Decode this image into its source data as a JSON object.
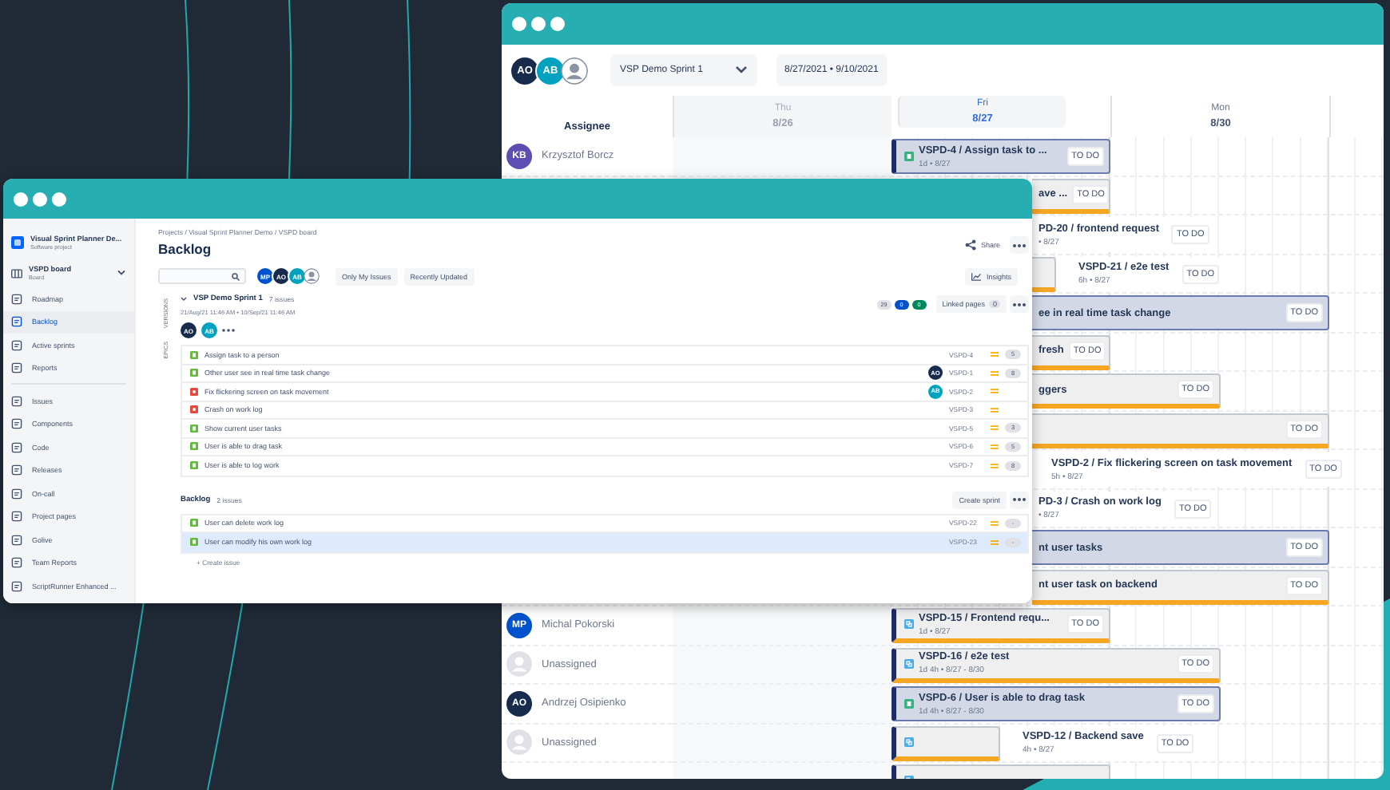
{
  "back_window": {
    "toolbar": {
      "avatars": [
        {
          "kind": "initials",
          "initials": "AO",
          "color": "#172b4d"
        },
        {
          "kind": "initials",
          "initials": "AB",
          "color": "#00a3bf"
        },
        {
          "kind": "unassigned"
        }
      ],
      "sprint_select": "VSP Demo Sprint 1",
      "date_range": "8/27/2021 • 9/10/2021"
    },
    "assignee_header": "Assignee",
    "days": [
      {
        "weekday": "Thu",
        "date": "8/26",
        "past": true,
        "selected": false
      },
      {
        "weekday": "Fri",
        "date": "8/27",
        "past": false,
        "selected": true
      },
      {
        "weekday": "Mon",
        "date": "8/30",
        "past": false,
        "selected": false
      }
    ],
    "rows": [
      {
        "assignee": {
          "kind": "initials",
          "initials": "KB",
          "name": "Krzysztof Borcz",
          "color": "#5e4db2"
        },
        "task": {
          "kind": "story",
          "bar": {
            "kind": "d1"
          },
          "label_outside": false,
          "cut": false,
          "title": "VSPD-4 / Assign task to ...",
          "meta": "1d • 8/27",
          "status": "TO DO"
        }
      },
      {
        "task": {
          "kind": "subtask",
          "bar": {
            "kind": "d1"
          },
          "label_outside": false,
          "cut": true,
          "title": "ave ...",
          "status": "TO DO"
        }
      },
      {
        "task": {
          "bar": {
            "kind": "h4"
          },
          "label_outside": true,
          "cut": true,
          "title": "PD-20 / frontend request",
          "meta": "• 8/27",
          "status": "TO DO"
        }
      },
      {
        "task": {
          "kind": "subtask",
          "bar": {
            "kind": "h6"
          },
          "label_outside": true,
          "cut": true,
          "title": "VSPD-21 / e2e test",
          "meta": "6h • 8/27",
          "status": "TO DO"
        }
      },
      {
        "task": {
          "kind": "story",
          "bar": {
            "kind": "d2"
          },
          "label_outside": false,
          "cut": true,
          "title": "ee in real time task change",
          "status": "TO DO"
        }
      },
      {
        "task": {
          "kind": "subtask",
          "bar": {
            "kind": "d1"
          },
          "label_outside": false,
          "cut": true,
          "title": "fresh",
          "status": "TO DO"
        }
      },
      {
        "task": {
          "kind": "subtask",
          "bar": {
            "kind": "d1h4"
          },
          "label_outside": false,
          "cut": true,
          "title": "ggers",
          "status": "TO DO"
        }
      },
      {
        "task": {
          "kind": "subtask",
          "bar": {
            "kind": "d2"
          },
          "label_outside": false,
          "cut": true,
          "status": "TO DO"
        }
      },
      {
        "task": {
          "bar": {
            "kind": "h5"
          },
          "label_outside": true,
          "cut": true,
          "title": "VSPD-2 / Fix flickering screen on task movement",
          "meta": "5h • 8/27",
          "status": "TO DO"
        }
      },
      {
        "task": {
          "bar": {
            "kind": "h4"
          },
          "label_outside": true,
          "cut": true,
          "title": "PD-3 / Crash on work log",
          "meta": "• 8/27",
          "status": "TO DO"
        }
      },
      {
        "task": {
          "kind": "story",
          "bar": {
            "kind": "d2"
          },
          "label_outside": false,
          "cut": true,
          "title": "nt user tasks",
          "status": "TO DO"
        }
      },
      {
        "task": {
          "kind": "subtask",
          "bar": {
            "kind": "d2"
          },
          "label_outside": false,
          "cut": true,
          "title": "nt user task on backend",
          "status": "TO DO"
        }
      },
      {
        "assignee": {
          "kind": "initials",
          "initials": "MP",
          "name": "Michal Pokorski",
          "color": "#0052cc"
        },
        "task": {
          "kind": "subtask",
          "bar": {
            "kind": "d1"
          },
          "label_outside": false,
          "cut": false,
          "title": "VSPD-15 / Frontend requ...",
          "meta": "1d • 8/27",
          "status": "TO DO"
        }
      },
      {
        "assignee": {
          "kind": "unassigned",
          "name": "Unassigned"
        },
        "task": {
          "kind": "subtask",
          "bar": {
            "kind": "d1h4"
          },
          "label_outside": false,
          "cut": false,
          "title": "VSPD-16 / e2e test",
          "meta": "1d 4h • 8/27 - 8/30",
          "status": "TO DO"
        }
      },
      {
        "assignee": {
          "kind": "initials",
          "initials": "AO",
          "name": "Andrzej Osipienko",
          "color": "#172b4d"
        },
        "task": {
          "kind": "story",
          "bar": {
            "kind": "d1h4"
          },
          "label_outside": false,
          "cut": false,
          "title": "VSPD-6 / User is able to drag task",
          "meta": "1d 4h • 8/27 - 8/30",
          "status": "TO DO"
        }
      },
      {
        "assignee": {
          "kind": "unassigned",
          "name": "Unassigned"
        },
        "task": {
          "kind": "subtask",
          "bar": {
            "kind": "h4"
          },
          "label_outside": true,
          "cut": false,
          "title": "VSPD-12 / Backend save",
          "meta": "4h • 8/27",
          "status": "TO DO"
        }
      },
      {
        "task": {
          "kind": "subtask",
          "bar": {
            "kind": "d1"
          },
          "cut": false
        }
      }
    ]
  },
  "front_window": {
    "sidebar": {
      "project": {
        "name": "Visual Sprint Planner De...",
        "type": "Software project"
      },
      "board": {
        "name": "VSPD board",
        "type": "Board"
      },
      "planning_items": [
        {
          "label": "Roadmap",
          "selected": false
        },
        {
          "label": "Backlog",
          "selected": true
        },
        {
          "label": "Active sprints",
          "selected": false
        },
        {
          "label": "Reports",
          "selected": false
        }
      ],
      "project_items": [
        {
          "label": "Issues",
          "selected": false
        },
        {
          "label": "Components",
          "selected": false
        },
        {
          "label": "Code",
          "selected": false
        },
        {
          "label": "Releases",
          "selected": false
        },
        {
          "label": "On-call",
          "selected": false
        },
        {
          "label": "Project pages",
          "selected": false
        },
        {
          "label": "Golive",
          "selected": false
        },
        {
          "label": "Team Reports",
          "selected": false
        },
        {
          "label": "ScriptRunner Enhanced ...",
          "selected": false
        }
      ]
    },
    "breadcrumb": "Projects / Visual Sprint Planner Demo / VSPD board",
    "title": "Backlog",
    "share": "Share",
    "filter_avatars": [
      {
        "kind": "initials",
        "initials": "MP",
        "color": "#0052cc"
      },
      {
        "kind": "initials",
        "initials": "AO",
        "color": "#172b4d"
      },
      {
        "kind": "initials",
        "initials": "AB",
        "color": "#00a3bf"
      },
      {
        "kind": "unassigned"
      }
    ],
    "filters": [
      "Only My Issues",
      "Recently Updated"
    ],
    "insights": "Insights",
    "side_tabs": [
      "VERSIONS",
      "EPICS"
    ],
    "sprint": {
      "name": "VSP Demo Sprint 1",
      "count": "7 issues",
      "dates": "21/Aug/21 11:46 AM • 10/Sep/21 11:46 AM",
      "avatars": [
        {
          "kind": "initials",
          "initials": "AO",
          "color": "#172b4d"
        },
        {
          "kind": "initials",
          "initials": "AB",
          "color": "#00a3bf"
        }
      ],
      "status_counts": [
        {
          "value": "29",
          "color": "#dfe1e6"
        },
        {
          "value": "0",
          "color": "#0052cc"
        },
        {
          "value": "0",
          "color": "#00875a"
        }
      ],
      "linked_pages": {
        "label": "Linked pages",
        "count": "0"
      },
      "issues": [
        {
          "kind": "story",
          "summary": "Assign task to a person",
          "key": "VSPD-4",
          "estimate": "5",
          "selected": false
        },
        {
          "kind": "story",
          "summary": "Other user see in real time task change",
          "assignee": {
            "kind": "initials",
            "initials": "AO",
            "color": "#172b4d"
          },
          "key": "VSPD-1",
          "estimate": "8",
          "selected": false
        },
        {
          "kind": "bug",
          "summary": "Fix flickering screen on task movement",
          "assignee": {
            "kind": "initials",
            "initials": "AB",
            "color": "#00a3bf"
          },
          "key": "VSPD-2",
          "selected": false
        },
        {
          "kind": "bug",
          "summary": "Crash on work log",
          "key": "VSPD-3",
          "selected": false
        },
        {
          "kind": "story",
          "summary": "Show current user tasks",
          "key": "VSPD-5",
          "estimate": "3",
          "selected": false
        },
        {
          "kind": "story",
          "summary": "User is able to drag task",
          "key": "VSPD-6",
          "estimate": "5",
          "selected": false
        },
        {
          "kind": "story",
          "summary": "User is able to log work",
          "key": "VSPD-7",
          "estimate": "8",
          "selected": false
        }
      ]
    },
    "backlog": {
      "name": "Backlog",
      "count": "2 issues",
      "create_sprint": "Create sprint",
      "issues": [
        {
          "kind": "story",
          "summary": "User can delete work log",
          "key": "VSPD-22",
          "estimate": "-",
          "selected": false
        },
        {
          "kind": "story",
          "summary": "User can modify his own work log",
          "key": "VSPD-23",
          "estimate": "-",
          "selected": true
        }
      ],
      "create_issue": "+ Create issue"
    }
  }
}
